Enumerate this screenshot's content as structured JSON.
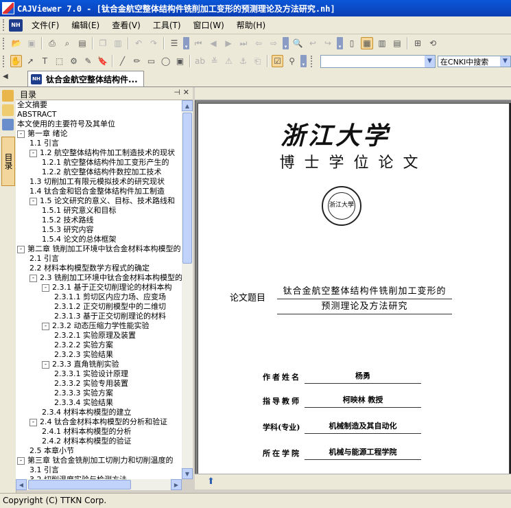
{
  "window": {
    "title": "CAJViewer 7.0 - [钛合金航空整体结构件铣削加工变形的预测理论及方法研究.nh]"
  },
  "menu": {
    "badge": "NH",
    "items": [
      "文件(F)",
      "编辑(E)",
      "查看(V)",
      "工具(T)",
      "窗口(W)",
      "帮助(H)"
    ]
  },
  "toolbar": {
    "search_value": "",
    "engine": "在CNKI中搜索"
  },
  "tabs": {
    "active": "钛合金航空整体结构件..."
  },
  "toc": {
    "header": "目录",
    "vertical_tab": "目录",
    "rows": [
      {
        "level": 0,
        "toggle": "",
        "text": "全文摘要"
      },
      {
        "level": 0,
        "toggle": "",
        "text": "ABSTRACT"
      },
      {
        "level": 0,
        "toggle": "",
        "text": "本文使用的主要符号及其单位"
      },
      {
        "level": 0,
        "toggle": "-",
        "text": "第一章 绪论"
      },
      {
        "level": 1,
        "toggle": "",
        "text": "1.1 引言"
      },
      {
        "level": 1,
        "toggle": "-",
        "text": "1.2 航空整体结构件加工制造技术的现状"
      },
      {
        "level": 2,
        "toggle": "",
        "text": "1.2.1 航空整体结构件加工变形产生的"
      },
      {
        "level": 2,
        "toggle": "",
        "text": "1.2.2 航空整体结构件数控加工技术"
      },
      {
        "level": 1,
        "toggle": "",
        "text": "1.3 切削加工有限元模拟技术的研究现状"
      },
      {
        "level": 1,
        "toggle": "",
        "text": "1.4 钛合金和铝合金整体结构件加工制造"
      },
      {
        "level": 1,
        "toggle": "-",
        "text": "1.5 论文研究的意义、目标、技术路线和"
      },
      {
        "level": 2,
        "toggle": "",
        "text": "1.5.1 研究意义和目标"
      },
      {
        "level": 2,
        "toggle": "",
        "text": "1.5.2 技术路线"
      },
      {
        "level": 2,
        "toggle": "",
        "text": "1.5.3 研究内容"
      },
      {
        "level": 2,
        "toggle": "",
        "text": "1.5.4 论文的总体框架"
      },
      {
        "level": 0,
        "toggle": "-",
        "text": "第二章 铣削加工环境中钛合金材料本构模型的"
      },
      {
        "level": 1,
        "toggle": "",
        "text": "2.1 引言"
      },
      {
        "level": 1,
        "toggle": "",
        "text": "2.2 材料本构模型数学方程式的确定"
      },
      {
        "level": 1,
        "toggle": "-",
        "text": "2.3 铣削加工环境中钛合金材料本构模型的"
      },
      {
        "level": 2,
        "toggle": "-",
        "text": "2.3.1 基于正交切削理论的材料本构"
      },
      {
        "level": 3,
        "toggle": "",
        "text": "2.3.1.1 剪切区内应力场、应变场"
      },
      {
        "level": 3,
        "toggle": "",
        "text": "2.3.1.2 正交切削模型中的二维切"
      },
      {
        "level": 3,
        "toggle": "",
        "text": "2.3.1.3 基于正交切削理论的材料"
      },
      {
        "level": 2,
        "toggle": "-",
        "text": "2.3.2 动态压缩力学性能实验"
      },
      {
        "level": 3,
        "toggle": "",
        "text": "2.3.2.1 实验原理及装置"
      },
      {
        "level": 3,
        "toggle": "",
        "text": "2.3.2.2 实验方案"
      },
      {
        "level": 3,
        "toggle": "",
        "text": "2.3.2.3 实验结果"
      },
      {
        "level": 2,
        "toggle": "-",
        "text": "2.3.3 直角铣削实验"
      },
      {
        "level": 3,
        "toggle": "",
        "text": "2.3.3.1 实验设计原理"
      },
      {
        "level": 3,
        "toggle": "",
        "text": "2.3.3.2 实验专用装置"
      },
      {
        "level": 3,
        "toggle": "",
        "text": "2.3.3.3 实验方案"
      },
      {
        "level": 3,
        "toggle": "",
        "text": "2.3.3.4 实验结果"
      },
      {
        "level": 2,
        "toggle": "",
        "text": "2.3.4 材料本构模型的建立"
      },
      {
        "level": 1,
        "toggle": "-",
        "text": "2.4 钛合金材料本构模型的分析和验证"
      },
      {
        "level": 2,
        "toggle": "",
        "text": "2.4.1 材料本构模型的分析"
      },
      {
        "level": 2,
        "toggle": "",
        "text": "2.4.2 材料本构模型的验证"
      },
      {
        "level": 1,
        "toggle": "",
        "text": "2.5 本章小节"
      },
      {
        "level": 0,
        "toggle": "-",
        "text": "第三章 钛合金铣削加工切削力和切削温度的"
      },
      {
        "level": 1,
        "toggle": "",
        "text": "3.1 引言"
      },
      {
        "level": 1,
        "toggle": "",
        "text": "3.2 切削温度实验与检测方法"
      }
    ]
  },
  "page": {
    "university": "浙江大学",
    "degree": "博士学位论文",
    "seal_text": "浙江大學",
    "thesis_label": "论文题目",
    "thesis_line1": "钛合金航空整体结构件铣削加工变形的",
    "thesis_line2": "预测理论及方法研究",
    "info": [
      {
        "label": "作者姓名",
        "value": "杨勇"
      },
      {
        "label": "指导教师",
        "value": "柯映林  教授"
      },
      {
        "label": "学科(专业)",
        "value": "机械制造及其自动化"
      },
      {
        "label": "所在学院",
        "value": "机械与能源工程学院"
      }
    ]
  },
  "status": {
    "text": "Copyright (C) TTKN Corp."
  }
}
